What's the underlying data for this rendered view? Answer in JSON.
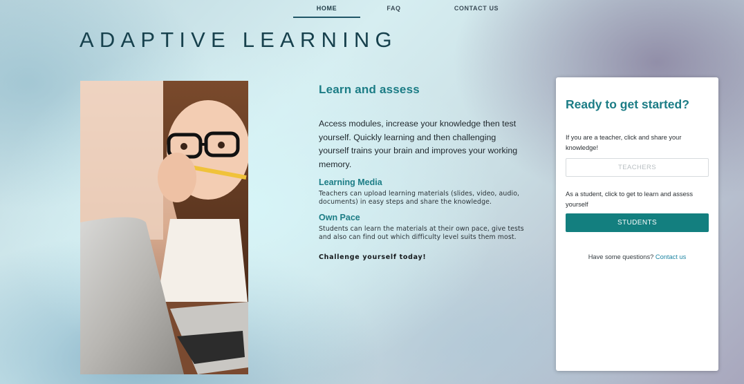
{
  "nav": {
    "home": "HOME",
    "faq": "FAQ",
    "contact": "CONTACT US"
  },
  "site_title": "ADAPTIVE LEARNING",
  "middle": {
    "heading": "Learn and assess",
    "intro": "Access modules, increase your knowledge then test yourself. Quickly learning and then challenging yourself trains your brain and improves your working memory.",
    "learning_media": {
      "heading": "Learning Media",
      "text": "Teachers can upload learning materials (slides, video, audio, documents) in easy steps and share the knowledge."
    },
    "own_pace": {
      "heading": "Own Pace",
      "text": "Students can learn the materials at their own pace, give tests and also can find out which difficulty level suits them most."
    },
    "challenge": "Challenge yourself today!"
  },
  "card": {
    "title": "Ready to get started?",
    "teacher_text": "If you are a teacher, click and share your knowledge!",
    "teachers_button": "TEACHERS",
    "student_text": "As a student, click to get to learn and assess yourself",
    "students_button": "STUDENTS",
    "questions_text": "Have some questions?",
    "contact_link": "Contact us"
  },
  "colors": {
    "accent": "#1b7c85",
    "button": "#137f7f",
    "title": "#17414d"
  }
}
